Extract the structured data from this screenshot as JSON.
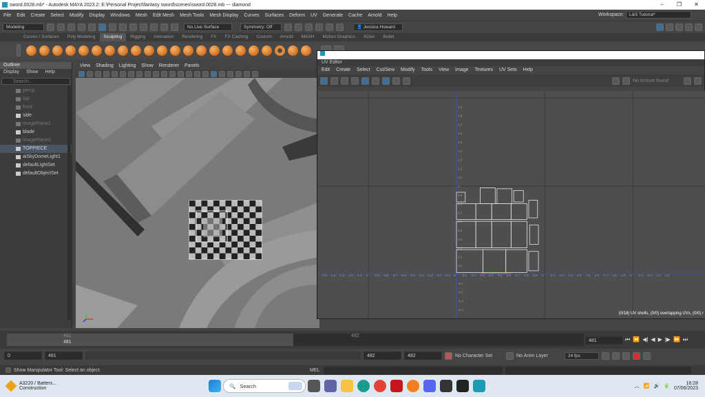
{
  "window": {
    "title": "sword.0028.mb* - Autodesk MAYA 2023.2: E:\\Personal Project\\fantasy sword\\scenes\\sword.0028.mb  ---  diamond"
  },
  "menubar": [
    "File",
    "Edit",
    "Create",
    "Select",
    "Modify",
    "Display",
    "Windows",
    "Mesh",
    "Edit Mesh",
    "Mesh Tools",
    "Mesh Display",
    "Curves",
    "Surfaces",
    "Deform",
    "UV",
    "Generate",
    "Cache",
    "Arnold",
    "Help"
  ],
  "workspace": {
    "label": "Workspace:",
    "value": "L&S Tutorial*"
  },
  "statusline": {
    "mode": "Modeling",
    "live": "No Live Surface",
    "symmetry": "Symmetry: Off",
    "user": "Jessica Howard"
  },
  "shelf_tabs": [
    "Curves / Surfaces",
    "Poly Modeling",
    "Sculpting",
    "Rigging",
    "Animation",
    "Rendering",
    "FX",
    "FX Caching",
    "Custom",
    "Arnold",
    "MASH",
    "Motion Graphics",
    "XGen",
    "Bullet"
  ],
  "shelf_active": "Sculpting",
  "outliner": {
    "title": "Outliner",
    "menu": [
      "Display",
      "Show",
      "Help"
    ],
    "search_placeholder": "Search...",
    "items": [
      {
        "label": "persp",
        "dim": true
      },
      {
        "label": "top",
        "dim": true
      },
      {
        "label": "front",
        "dim": true
      },
      {
        "label": "side",
        "dim": false
      },
      {
        "label": "imagePlane1",
        "dim": true
      },
      {
        "label": "blade",
        "dim": false
      },
      {
        "label": "imagePlane2",
        "dim": true
      },
      {
        "label": "TOPPIECE",
        "dim": false,
        "selected": true
      },
      {
        "label": "aiSkyDomeLight1",
        "dim": false
      },
      {
        "label": "defaultLightSet",
        "dim": false
      },
      {
        "label": "defaultObjectSet",
        "dim": false
      }
    ]
  },
  "viewport_menu": [
    "View",
    "Shading",
    "Lighting",
    "Show",
    "Renderer",
    "Panels"
  ],
  "uv_editor": {
    "title": "UV Editor",
    "menu": [
      "Edit",
      "Create",
      "Select",
      "Cut/Sew",
      "Modify",
      "Tools",
      "View",
      "Image",
      "Textures",
      "UV Sets",
      "Help"
    ],
    "texture": "No texture found",
    "status": "(0/18) UV shells, (0/0) overlapping UVs, (0/0) r",
    "h_ticks": [
      "-1.6",
      "-1.5",
      "-1.4",
      "-1.3",
      "-1.2",
      "-1.1",
      "-1",
      "-0.9",
      "-0.8",
      "-0.7",
      "-0.6",
      "-0.5",
      "-0.4",
      "-0.3",
      "-0.2",
      "-0.1",
      "0",
      "0.1",
      "0.2",
      "0.3",
      "0.4",
      "0.5",
      "0.6",
      "0.7",
      "0.8",
      "0.9",
      "1",
      "1.1",
      "1.2",
      "1.3",
      "1.4",
      "1.5",
      "1.6",
      "1.7",
      "1.8",
      "1.9",
      "2",
      "2.1",
      "2.2",
      "2.3",
      "2.4"
    ],
    "v_ticks": [
      "1.9",
      "1.8",
      "1.7",
      "1.6",
      "1.5",
      "1.4",
      "1.3",
      "1.2",
      "1.1",
      "1",
      "0.9",
      "0.8",
      "0.7",
      "0.6",
      "0.5",
      "0.4",
      "0.3",
      "0.2",
      "0.1",
      "0",
      "-0.1",
      "-0.2",
      "-0.3",
      "-0.4"
    ]
  },
  "timeslider": {
    "left": "481",
    "mid": "482",
    "current": "481"
  },
  "range": {
    "start": "0",
    "playstart": "481",
    "playend": "482",
    "end": "482",
    "character": "No Character Set",
    "anim_layer": "No Anim Layer",
    "fps": "24 fps"
  },
  "helpline": {
    "text": "Show Manipulator Tool: Select an object.",
    "mel": "MEL"
  },
  "taskbar": {
    "battery_title": "A3220 / Batters...",
    "battery_sub": "Construction",
    "search": "Search",
    "time": "16:28",
    "date": "07/06/2023"
  }
}
